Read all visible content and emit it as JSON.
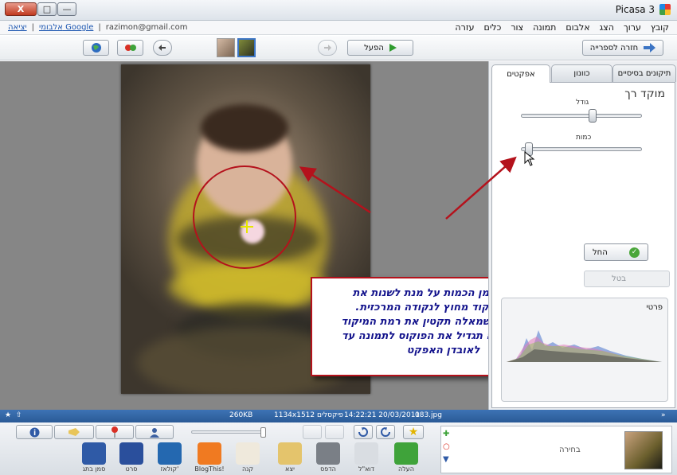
{
  "window": {
    "title": "Picasa 3",
    "controls": {
      "minimize": "—",
      "maximize": "□",
      "close": "X"
    }
  },
  "account": {
    "signout": "יציאה",
    "albums": "אלבומי Google",
    "email": "razimon@gmail.com"
  },
  "menu": [
    "קובץ",
    "ערוך",
    "הצג",
    "אלבום",
    "תמונה",
    "צור",
    "כלים",
    "עזרה"
  ],
  "toolbar": {
    "back_to_library": "חזרה לספרייה",
    "play": "הפעל"
  },
  "tabs": [
    "תיקונים בסיסיים",
    "כוונון",
    "אפקטים"
  ],
  "effect_panel": {
    "title": "מוקד רך",
    "size_label": "גודל",
    "amount_label": "כמות",
    "size_value": 0.6,
    "amount_value": 0.03,
    "apply": "החל",
    "cancel": "בטל",
    "histogram_label": "פרטי"
  },
  "callout": {
    "lines": [
      "נזיז את סמן הכמות על מנת לשנות את",
      "רמת המיקוד מחוץ לנקודה המרכזית.",
      "הזזת הסמן שמאלה תקטין את רמת המיקוד",
      "והזזתו ימינה תגדיל את הפוקוס לתמונה עד",
      "לאובדן האפקט"
    ]
  },
  "status": {
    "filename": "083.jpg",
    "datetime": "14:22:21 20/03/2011",
    "dimensions": "1134x1512 פיקסלים",
    "filesize": "260KB"
  },
  "tray": {
    "selection_label": "בחירה"
  },
  "bottom_actions": [
    {
      "label": "העלה",
      "icon": "upload-icon",
      "color": "#3fa33a"
    },
    {
      "label": "דוא\"ל",
      "icon": "email-icon",
      "color": "#d9dde2"
    },
    {
      "label": "הדפס",
      "icon": "print-icon",
      "color": "#7a7f86"
    },
    {
      "label": "יצא",
      "icon": "export-folder-icon",
      "color": "#e4c46c"
    },
    {
      "label": "קנה",
      "icon": "shop-icon",
      "color": "#efe9dc"
    },
    {
      "label": "BlogThis!",
      "icon": "blogger-icon",
      "color": "#f07a21"
    },
    {
      "label": "קולאז'",
      "icon": "collage-icon",
      "color": "#2468b0"
    },
    {
      "label": "סרט",
      "icon": "movie-icon",
      "color": "#2a4f9c"
    },
    {
      "label": "סמן בתג",
      "icon": "geotag-icon",
      "color": "#2f5aa6"
    }
  ],
  "colors": {
    "accent_red": "#b4121c",
    "callout_text": "#13138c",
    "statusbar": "#2f63a3"
  }
}
